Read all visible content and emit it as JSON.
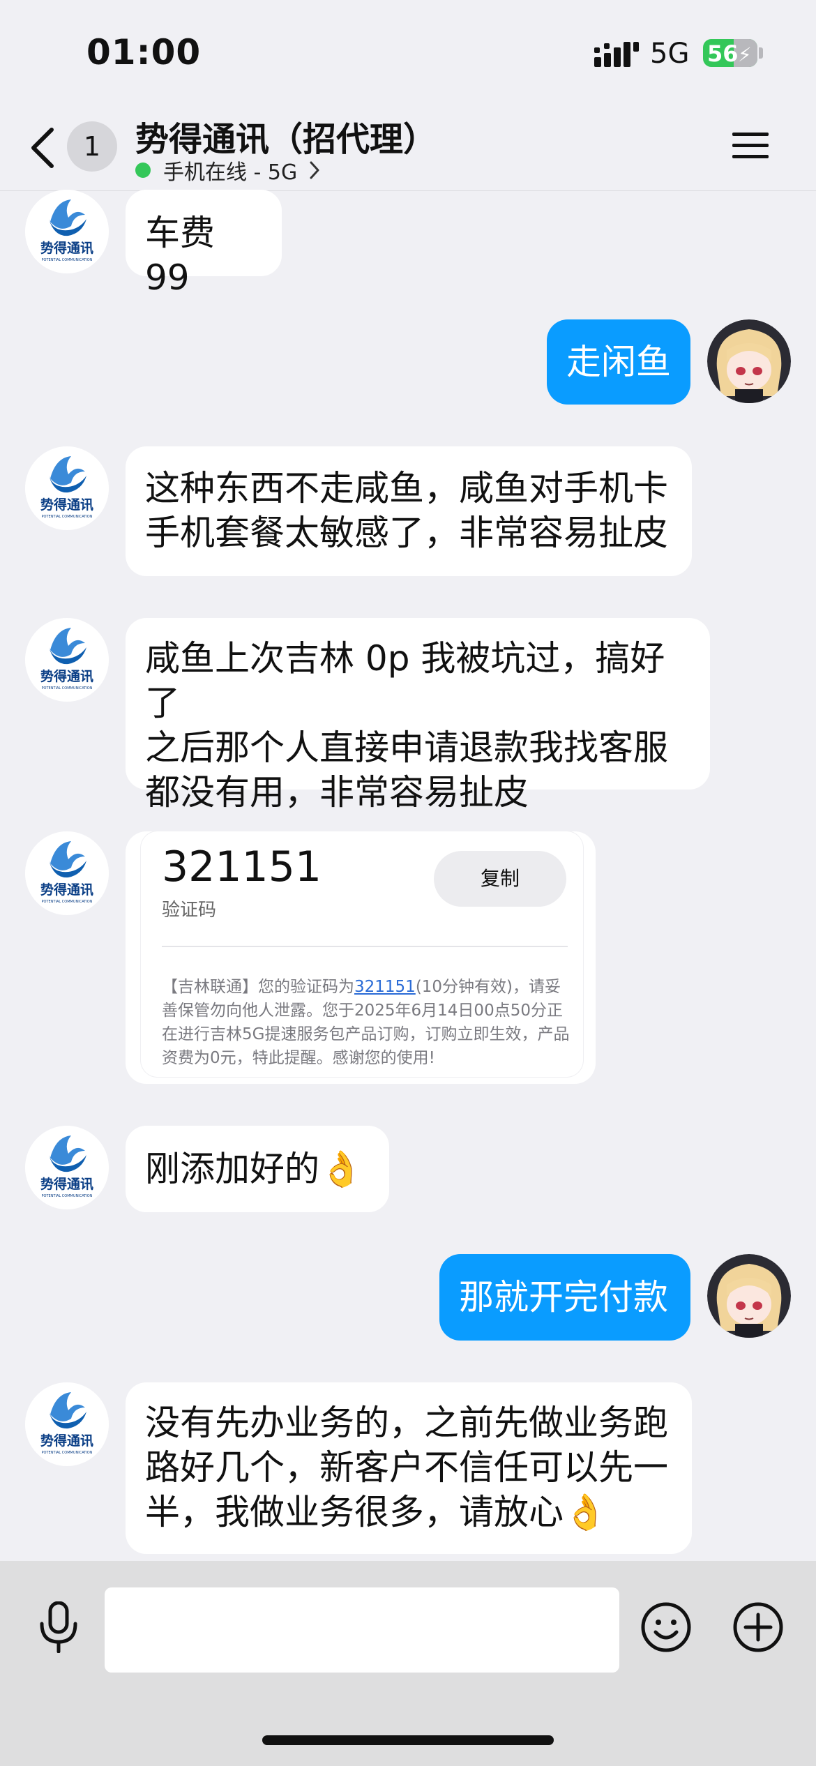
{
  "status": {
    "time": "01:00",
    "network": "5G",
    "battery": "56"
  },
  "nav": {
    "unread_count": "1",
    "title": "势得通讯（招代理）",
    "subtitle": "手机在线 - 5G"
  },
  "messages": [
    {
      "side": "in",
      "lines": [
        "车费 99"
      ]
    },
    {
      "side": "out",
      "lines": [
        "走闲鱼"
      ]
    },
    {
      "side": "in",
      "lines": [
        "这种东西不走咸鱼，咸鱼对手机卡",
        "手机套餐太敏感了，非常容易扯皮"
      ]
    },
    {
      "side": "in",
      "lines": [
        "咸鱼上次吉林 0p 我被坑过，搞好了",
        "之后那个人直接申请退款我找客服",
        "都没有用，非常容易扯皮"
      ]
    },
    {
      "side": "in",
      "lines": [
        "刚添加好的👌"
      ]
    },
    {
      "side": "out",
      "lines": [
        "那就开完付款"
      ]
    },
    {
      "side": "in",
      "lines": [
        "没有先办业务的，之前先做业务跑",
        "路好几个，新客户不信任可以先一",
        "半，我做业务很多，请放心👌"
      ]
    }
  ],
  "card": {
    "code": "321151",
    "code_label": "验证码",
    "copy_label": "复制",
    "sms_prefix": "【吉林联通】您的验证码为",
    "sms_code": "321151",
    "sms_suffix": "(10分钟有效)，请妥善保管勿向他人泄露。您于2025年6月14日00点50分正在进行吉林5G提速服务包产品订购，订购立即生效，产品资费为0元，特此提醒。感谢您的使用!"
  },
  "avatar_logo": {
    "brand": "势得通讯",
    "sub": "POTENTIAL COMMUNICATION"
  },
  "input": {
    "placeholder": ""
  },
  "colors": {
    "accent": "#0a9cff",
    "online": "#34c759",
    "background": "#f0f0f4"
  },
  "icons": [
    "back-icon",
    "menu-icon",
    "mic-icon",
    "emoji-icon",
    "plus-icon"
  ]
}
